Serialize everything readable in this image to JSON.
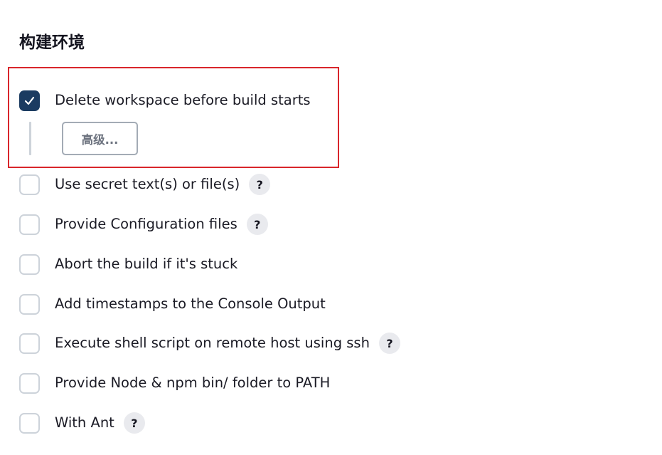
{
  "section": {
    "title": "构建环境"
  },
  "options": [
    {
      "label": "Delete workspace before build starts",
      "checked": true,
      "help": false
    },
    {
      "label": "Use secret text(s) or file(s)",
      "checked": false,
      "help": true
    },
    {
      "label": "Provide Configuration files",
      "checked": false,
      "help": true
    },
    {
      "label": "Abort the build if it's stuck",
      "checked": false,
      "help": false
    },
    {
      "label": "Add timestamps to the Console Output",
      "checked": false,
      "help": false
    },
    {
      "label": "Execute shell script on remote host using ssh",
      "checked": false,
      "help": true
    },
    {
      "label": "Provide Node & npm bin/ folder to PATH",
      "checked": false,
      "help": false
    },
    {
      "label": "With Ant",
      "checked": false,
      "help": true
    }
  ],
  "advanced_button": {
    "label": "高级..."
  },
  "help_glyph": "?",
  "colors": {
    "checked_bg": "#1b3b61",
    "highlight_border": "#d9262b",
    "help_bg": "#e9eaee"
  },
  "icons": {
    "check": "checkmark-icon",
    "help": "question-mark-icon"
  }
}
